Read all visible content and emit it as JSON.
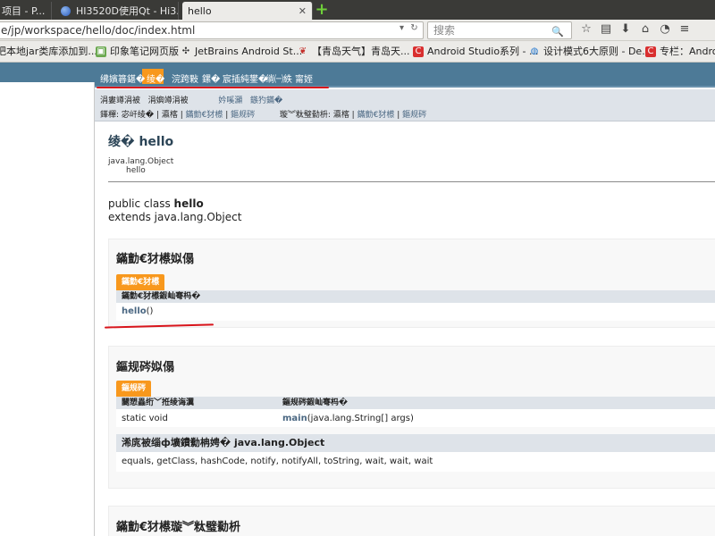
{
  "tabs": [
    {
      "label": "项目 - P...",
      "icon": "page-icon"
    },
    {
      "label": "HI3520D使用Qt - Hi3...",
      "icon": "globe-icon"
    },
    {
      "label": "hello",
      "active": true
    }
  ],
  "url": "e/jp/workspace/hello/doc/index.html",
  "search_placeholder": "搜索",
  "bookmarks": [
    "把本地jar类库添加到...",
    "印象笔记网页版",
    "JetBrains Android St...",
    "【青岛天气】青岛天...",
    "Android Studio系列 - ...",
    "设计模式6大原则 - De...",
    "专栏：Androi"
  ],
  "topnav": [
    "绋嬪簭鍖�",
    "绫�",
    "浣跨敤",
    "鏍�",
    "宸插純鐢�",
    "绱㈠紩",
    "甯姪"
  ],
  "subnav": {
    "row1": [
      "涓婁竴涓被",
      "涓嬩竴涓被",
      "妗嗘灦",
      "鏃犳鏋�"
    ],
    "row2_prefix": "鎽樿: 宓屽绫� | 瀛楁 |",
    "row2_links": [
      "鏋勯€犲櫒",
      "鏂规硶"
    ],
    "row2_detail": "璇︾粏璧勬枡: 瀛楁 |",
    "row2_detail_links": [
      "鏋勯€犲櫒",
      "鏂规硶"
    ]
  },
  "page_title": "绫� hello",
  "inheritance": {
    "parent": "java.lang.Object",
    "child": "hello"
  },
  "declaration": {
    "line1_prefix": "public class",
    "class_name": "hello",
    "line2": "extends java.lang.Object"
  },
  "constructor_summary": {
    "heading": "鏋勯€犲櫒姒傝",
    "caption": "鏋勯€犲櫒",
    "col_header": "鏋勯€犲櫒鍜屾弿杩�",
    "row_name": "hello",
    "row_suffix": "()"
  },
  "method_summary": {
    "heading": "鏂规硶姒傝",
    "caption": "鏂规硶",
    "col1_header": "闄愬畾绗﹀拰绫诲瀷",
    "col2_header": "鏂规硶鍜屾弿杩�",
    "row_type": "static void",
    "row_method": "main",
    "row_args": "(java.lang.String[] args)"
  },
  "inherited": {
    "heading": "浠庣被缁ф壙鐨勬柟娉� java.lang.Object",
    "methods": "equals, getClass, hashCode, notify, notifyAll, toString, wait, wait, wait"
  },
  "constructor_detail_heading": "鏋勯€犲櫒璇︾粏璧勬枡"
}
